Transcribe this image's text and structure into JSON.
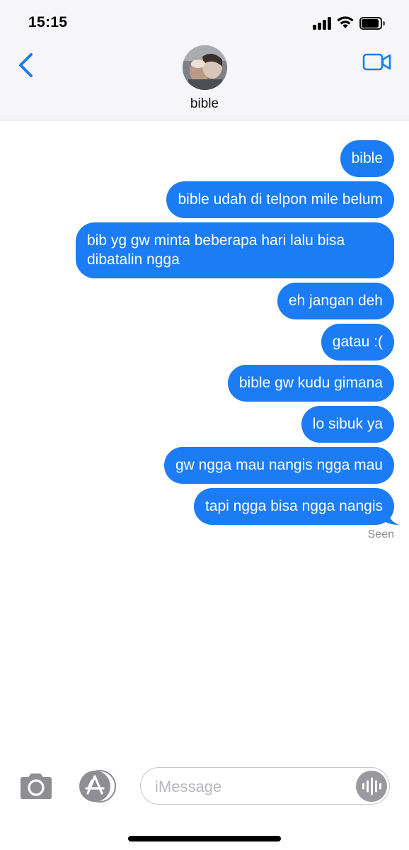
{
  "status": {
    "time": "15:15"
  },
  "header": {
    "contact_name": "bible"
  },
  "messages": [
    {
      "text": "bible"
    },
    {
      "text": "bible udah di telpon mile belum"
    },
    {
      "text": "bib yg gw minta beberapa hari lalu bisa dibatalin ngga"
    },
    {
      "text": "eh jangan deh"
    },
    {
      "text": "gatau :("
    },
    {
      "text": "bible gw kudu gimana"
    },
    {
      "text": "lo sibuk ya"
    },
    {
      "text": "gw ngga mau nangis ngga mau"
    },
    {
      "text": "tapi ngga bisa ngga nangis"
    }
  ],
  "read_receipt": "Seen",
  "composer": {
    "placeholder": "iMessage"
  },
  "colors": {
    "bubble": "#1b7cf5",
    "accent": "#1b7cf5"
  },
  "icons": [
    "back-chevron-icon",
    "video-call-icon",
    "camera-icon",
    "app-store-icon",
    "audio-waveform-icon"
  ]
}
